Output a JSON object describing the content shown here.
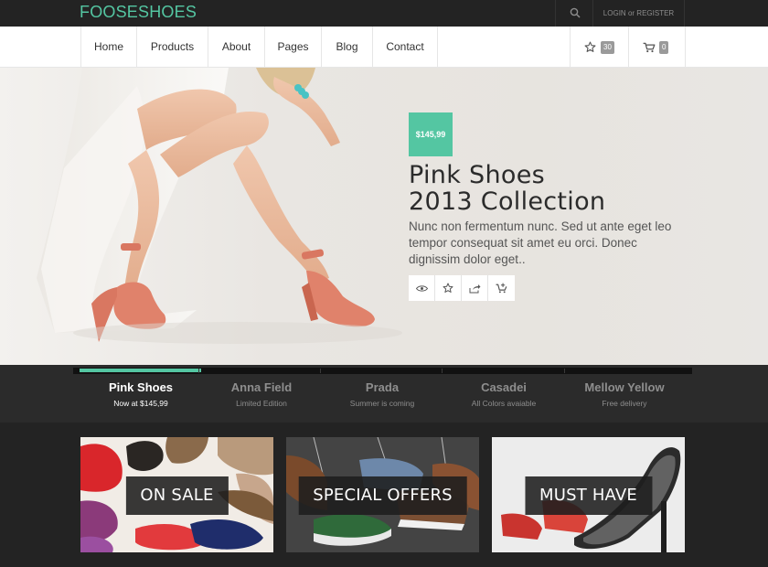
{
  "brand": {
    "logo": "FOOSESHOES",
    "accent": "#54c6a2"
  },
  "topbar": {
    "login": "LOGIN",
    "or": "or",
    "register": "REGISTER",
    "search_icon": "search-icon"
  },
  "nav": {
    "items": [
      {
        "label": "Home"
      },
      {
        "label": "Products"
      },
      {
        "label": "About"
      },
      {
        "label": "Pages"
      },
      {
        "label": "Blog"
      },
      {
        "label": "Contact"
      }
    ],
    "wishlist_count": "30",
    "cart_count": "0"
  },
  "hero": {
    "price": "$145,99",
    "title_line1": "Pink Shoes",
    "title_line2": "2013 Collection",
    "description": "Nunc non fermentum nunc. Sed ut ante eget leo tempor consequat sit amet eu orci. Donec dignissim dolor eget..",
    "actions": [
      "view-icon",
      "star-icon",
      "share-icon",
      "add-to-cart-icon"
    ]
  },
  "slider": {
    "progress": 0.2,
    "slides": [
      {
        "name": "Pink Shoes",
        "sub": "Now at $145,99"
      },
      {
        "name": "Anna Field",
        "sub": "Limited Edition"
      },
      {
        "name": "Prada",
        "sub": "Summer is coming"
      },
      {
        "name": "Casadei",
        "sub": "All Colors avaiable"
      },
      {
        "name": "Mellow Yellow",
        "sub": "Free delivery"
      }
    ]
  },
  "tiles": [
    {
      "label": "ON SALE"
    },
    {
      "label": "SPECIAL OFFERS"
    },
    {
      "label": "MUST HAVE"
    }
  ]
}
